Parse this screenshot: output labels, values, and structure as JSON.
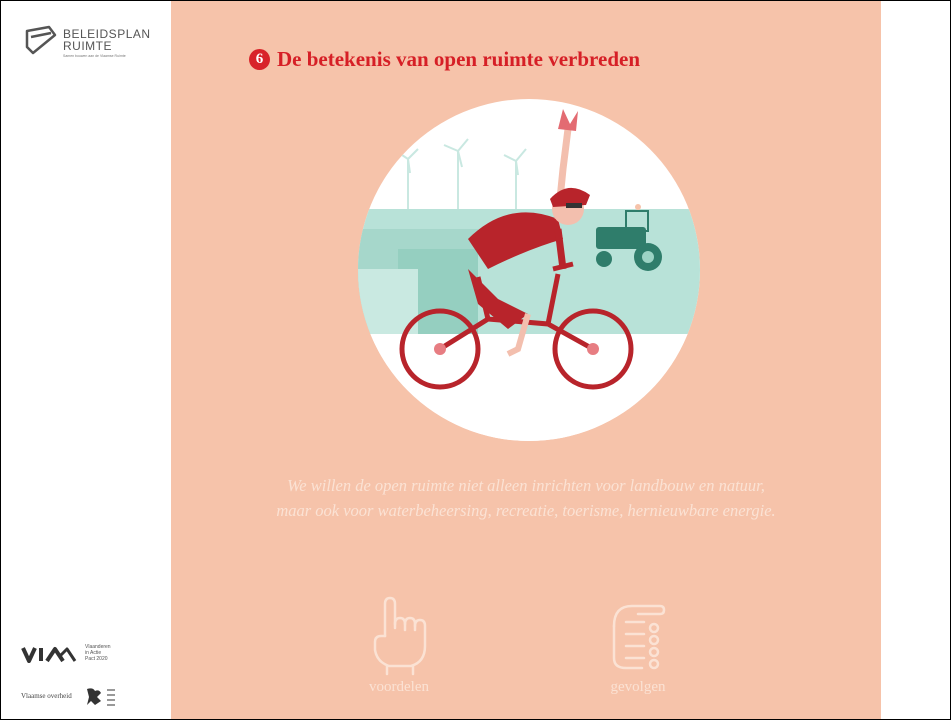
{
  "brand": {
    "title_line1": "BELEIDSPLAN",
    "title_line2": "RUIMTE",
    "subtitle": "Samen bouwen aan de Vlaamse Ruimte"
  },
  "slide": {
    "number": "6",
    "heading": "De betekenis van open ruimte verbreden",
    "quote_line1": "We willen de open ruimte niet alleen inrichten voor landbouw en natuur,",
    "quote_line2": "maar ook voor waterbeheersing, recreatie, toerisme, hernieuwbare energie."
  },
  "nav": {
    "voordelen_label": "voordelen",
    "voordelen_icon": "pointing-finger-icon",
    "gevolgen_label": "gevolgen",
    "gevolgen_icon": "hand-pointing-icon"
  },
  "footer": {
    "via_text": "Vlaanderen\nin Actie\nPact 2020",
    "vo_text": "Vlaamse overheid"
  },
  "colors": {
    "panel": "#f6c3aa",
    "heading": "#d61f26",
    "badge": "#d8232a",
    "light_text": "#fbe2d4"
  }
}
